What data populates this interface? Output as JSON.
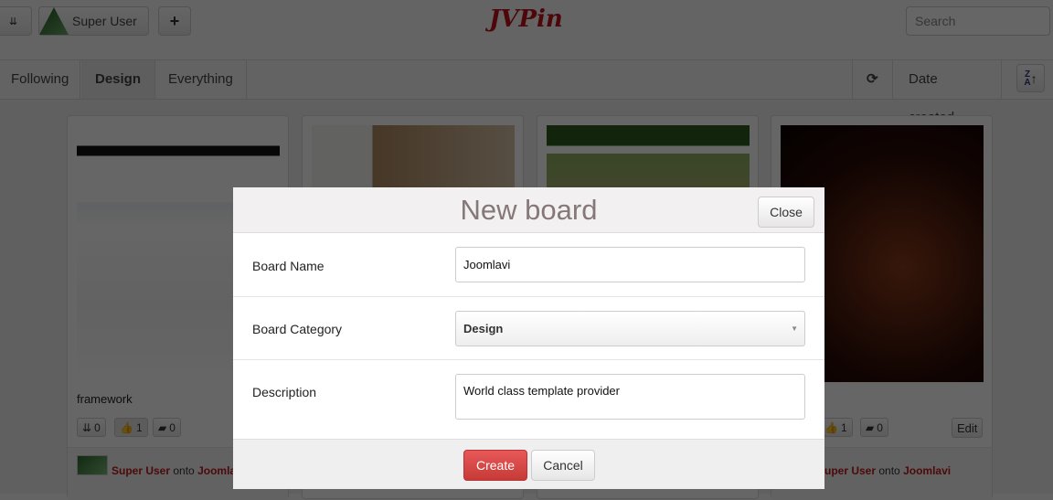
{
  "topbar": {
    "user_name": "Super User",
    "logo_text": "JVPin",
    "search_placeholder": "Search"
  },
  "nav": {
    "tabs": [
      {
        "label": "Following"
      },
      {
        "label": "Design",
        "active": true
      },
      {
        "label": "Everything"
      }
    ],
    "sort_label": "Date created"
  },
  "cards": [
    {
      "title": "framework",
      "repins": "0",
      "likes": "1",
      "comments": "0",
      "user": "Super User",
      "onto": "onto",
      "board": "Joomlavi"
    },
    {
      "title": "",
      "repins": "",
      "likes": "",
      "comments": "",
      "user": "",
      "onto": "",
      "board": ""
    },
    {
      "title": "",
      "repins": "",
      "likes": "",
      "comments": "",
      "user": "",
      "onto": "",
      "board": ""
    },
    {
      "title": "",
      "repins": "",
      "likes": "1",
      "comments": "0",
      "edit": "Edit",
      "user": "Super User",
      "onto": "onto",
      "board": "Joomlavi"
    }
  ],
  "modal": {
    "title": "New board",
    "close_label": "Close",
    "fields": {
      "name_label": "Board Name",
      "name_value": "Joomlavi",
      "category_label": "Board Category",
      "category_value": "Design",
      "description_label": "Description",
      "description_value": "World class template provider"
    },
    "create_label": "Create",
    "cancel_label": "Cancel"
  },
  "colors": {
    "accent": "#a0101a",
    "create_button": "#d9403f",
    "overlay": "rgba(0,0,0,0.68)"
  }
}
